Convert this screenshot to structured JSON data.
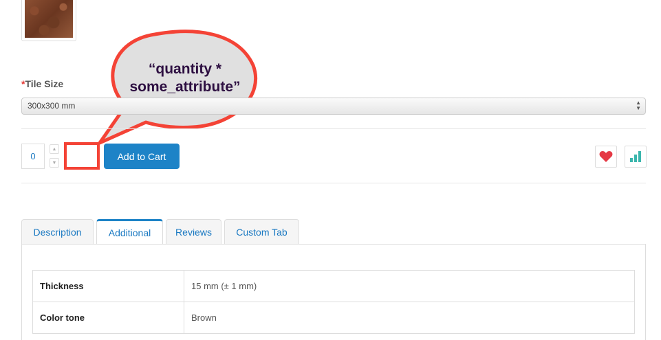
{
  "product": {
    "option_label": "Tile Size",
    "option_required_mark": "*",
    "option_selected": "300x300 mm",
    "quantity_value": "0",
    "add_to_cart_label": "Add to Cart"
  },
  "annotation": {
    "line1": "“quantity *",
    "line2": "some_attribute”"
  },
  "tabs": [
    {
      "label": "Description",
      "active": false
    },
    {
      "label": "Additional",
      "active": true
    },
    {
      "label": "Reviews",
      "active": false
    },
    {
      "label": "Custom Tab",
      "active": false
    }
  ],
  "specs": [
    {
      "key": "Thickness",
      "value": "15 mm (± 1 mm)"
    },
    {
      "key": "Color tone",
      "value": "Brown"
    }
  ],
  "colors": {
    "accent": "#1d83c7",
    "callout_border": "#f44336",
    "wishlist_heart": "#e53945",
    "compare_bars": "#3bb6ad"
  }
}
